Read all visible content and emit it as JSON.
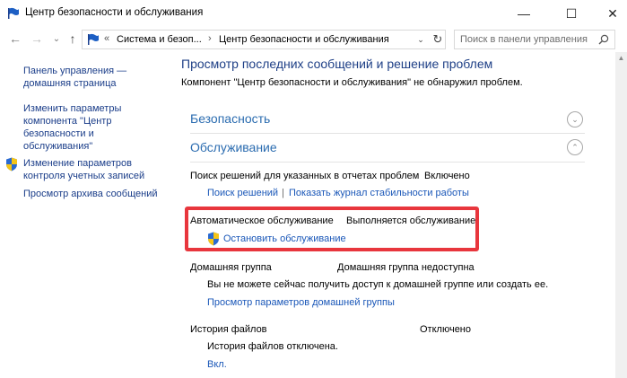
{
  "window": {
    "title": "Центр безопасности и обслуживания",
    "minimize_glyph": "—",
    "maximize_glyph": "☐",
    "close_glyph": "✕"
  },
  "nav": {
    "back_glyph": "←",
    "forward_glyph": "→",
    "dropdown_glyph": "⌄",
    "up_glyph": "↑",
    "breadcrumb_overflow": "«",
    "breadcrumbs": [
      "Система и безоп...",
      "Центр безопасности и обслуживания"
    ],
    "crumb_sep": "›",
    "address_dropdown": "⌄",
    "refresh_glyph": "↻",
    "search_placeholder": "Поиск в панели управления"
  },
  "sidebar": {
    "items": [
      {
        "label_1": "Панель управления —",
        "label_2": "домашняя страница"
      },
      {
        "label_1": "Изменить параметры",
        "label_2": "компонента \"Центр",
        "label_3": "безопасности и",
        "label_4": "обслуживания\""
      },
      {
        "label_1": "Изменение параметров",
        "label_2": "контроля учетных записей"
      },
      {
        "label_1": "Просмотр архива сообщений"
      }
    ]
  },
  "main": {
    "heading": "Просмотр последних сообщений и решение проблем",
    "subheading": "Компонент \"Центр безопасности и обслуживания\" не обнаружил проблем.",
    "security": {
      "title": "Безопасность",
      "toggle_glyph": "⌄"
    },
    "maintenance": {
      "title": "Обслуживание",
      "toggle_glyph": "⌃",
      "problem_reports": {
        "label": "Поиск решений для указанных в отчетах проблем",
        "status": "Включено",
        "link_find": "Поиск решений",
        "separator": "|",
        "link_history": "Показать журнал стабильности работы"
      },
      "auto_maintenance": {
        "label": "Автоматическое обслуживание",
        "status": "Выполняется обслуживание",
        "link_stop": "Остановить обслуживание"
      },
      "homegroup": {
        "label": "Домашняя группа",
        "status": "Домашняя группа недоступна",
        "description": "Вы не можете сейчас получить доступ к домашней группе или создать ее.",
        "link": "Просмотр параметров домашней группы"
      },
      "file_history": {
        "label": "История файлов",
        "status": "Отключено",
        "description": "История файлов отключена.",
        "link": "Вкл."
      }
    }
  },
  "colors": {
    "highlight": "#e8363d",
    "heading": "#1e3f86",
    "section": "#2b6cb0",
    "link": "#1a57b8"
  }
}
